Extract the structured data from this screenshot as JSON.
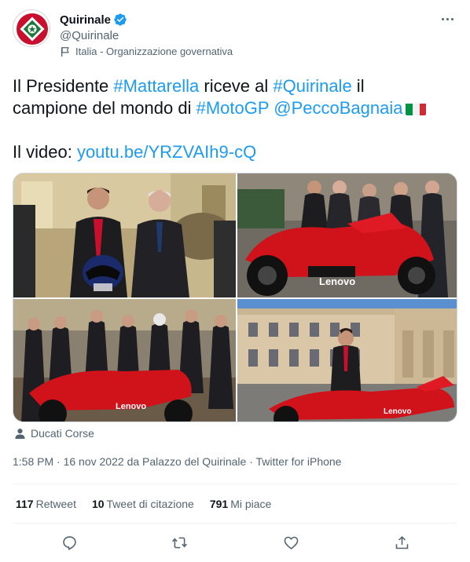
{
  "account": {
    "display_name": "Quirinale",
    "handle": "@Quirinale",
    "affiliation": "Italia - Organizzazione governativa"
  },
  "tweet": {
    "part1": "Il Presidente ",
    "hashtag1": "#Mattarella",
    "part2": " riceve al ",
    "hashtag2": "#Quirinale",
    "part3": " il",
    "part4": "campione del mondo di ",
    "hashtag3": "#MotoGP",
    "part5": " ",
    "mention": "@PeccoBagnaia",
    "video_label": "Il video: ",
    "video_link": "youtu.be/YRZVAIh9-cQ"
  },
  "media": {
    "photo1_helmet_text": "",
    "photo2_brand": "Lenovo",
    "photo3_brand": "Lenovo",
    "photo4_brand": "Lenovo"
  },
  "tagged": "Ducati Corse",
  "meta": {
    "time": "1:58 PM",
    "date": "16 nov 2022",
    "from_label": "da",
    "place": "Palazzo del Quirinale",
    "client": "Twitter for iPhone",
    "sep": "·"
  },
  "stats": {
    "retweets_count": "117",
    "retweets_label": "Retweet",
    "quotes_count": "10",
    "quotes_label": "Tweet di citazione",
    "likes_count": "791",
    "likes_label": "Mi piace"
  },
  "colors": {
    "link": "#1d9bf0",
    "text": "#0f1419",
    "secondary": "#536471",
    "ducati_red": "#d0121b"
  },
  "icons": {
    "verified": "verified-badge-icon",
    "more": "more-icon",
    "affiliation": "flag-icon",
    "tag": "person-icon",
    "reply": "reply-icon",
    "retweet": "retweet-icon",
    "like": "heart-icon",
    "share": "share-icon"
  }
}
